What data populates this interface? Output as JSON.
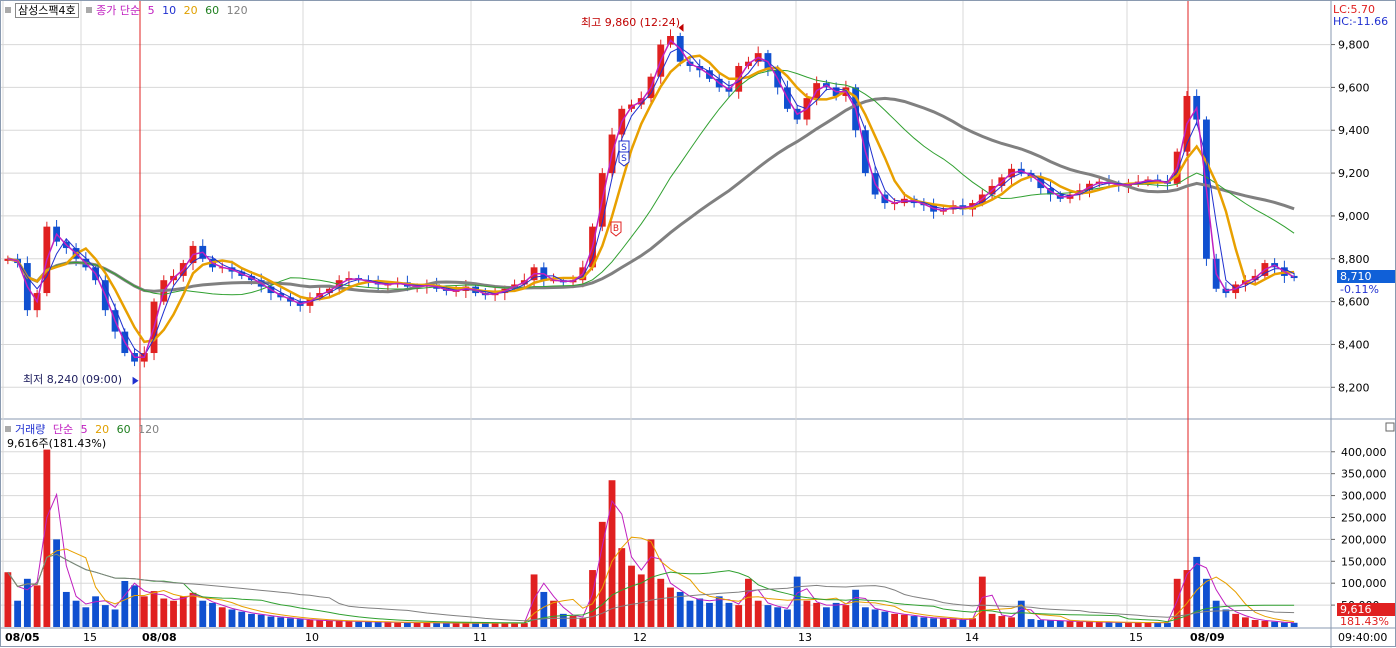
{
  "price_legend": {
    "symbol": "삼성스팩4호",
    "type_label": "종가 단순",
    "periods": [
      "5",
      "10",
      "20",
      "60",
      "120"
    ],
    "period_colors": [
      "#c020c0",
      "#2030d0",
      "#e0a000",
      "#208020",
      "#808080"
    ]
  },
  "volume_legend": {
    "title": "거래량",
    "type_label": "단순",
    "periods": [
      "5",
      "20",
      "60",
      "120"
    ],
    "period_colors": [
      "#c020c0",
      "#e0a000",
      "#208020",
      "#808080"
    ],
    "value_text": "9,616주(181.43%)"
  },
  "indicators": {
    "lc": "LC:5.70",
    "hc": "HC:-11.66"
  },
  "price_tag": {
    "value": "8,710",
    "change": "-0.11%"
  },
  "volume_tag": {
    "value": "9,616",
    "pct": "181.43%"
  },
  "annotations": {
    "high": "최고 9,860 (12:24)",
    "low": "최저 8,240 (09:00)",
    "signals": [
      "S",
      "S",
      "B"
    ]
  },
  "x_labels": [
    "08/05",
    "15",
    "08/08",
    "10",
    "11",
    "12",
    "13",
    "14",
    "15",
    "08/09"
  ],
  "time_label": "09:40:00",
  "colors": {
    "up": "#e02020",
    "down": "#1050d0",
    "ma5": "#c020c0",
    "ma10": "#2030d0",
    "ma20": "#e8a000",
    "ma60": "#30a030",
    "ma120": "#808080",
    "grid": "#d8d8d8"
  },
  "chart_data": [
    {
      "type": "candlestick",
      "title": "삼성스팩4호",
      "y_ticks": [
        8200,
        8400,
        8600,
        8800,
        9000,
        9200,
        9400,
        9600,
        9800
      ],
      "ylim": [
        8080,
        9910
      ],
      "day_labels": [
        "08/05",
        "15",
        "08/08",
        "10",
        "11",
        "12",
        "13",
        "14",
        "15",
        "08/09"
      ],
      "close_path": [
        8800,
        8780,
        8560,
        8640,
        8950,
        8880,
        8850,
        8800,
        8760,
        8700,
        8560,
        8460,
        8360,
        8320,
        8360,
        8600,
        8700,
        8720,
        8780,
        8860,
        8800,
        8760,
        8760,
        8740,
        8720,
        8700,
        8670,
        8640,
        8620,
        8600,
        8580,
        8620,
        8640,
        8660,
        8700,
        8710,
        8700,
        8690,
        8680,
        8680,
        8690,
        8670,
        8670,
        8680,
        8660,
        8650,
        8650,
        8670,
        8640,
        8630,
        8640,
        8660,
        8680,
        8700,
        8760,
        8700,
        8700,
        8690,
        8700,
        8760,
        8950,
        9200,
        9380,
        9500,
        9520,
        9550,
        9650,
        9800,
        9840,
        9720,
        9700,
        9680,
        9640,
        9600,
        9580,
        9700,
        9720,
        9760,
        9680,
        9600,
        9500,
        9450,
        9550,
        9620,
        9600,
        9560,
        9600,
        9400,
        9200,
        9100,
        9060,
        9060,
        9080,
        9060,
        9050,
        9020,
        9030,
        9050,
        9030,
        9060,
        9100,
        9140,
        9180,
        9220,
        9200,
        9180,
        9130,
        9100,
        9080,
        9100,
        9120,
        9150,
        9160,
        9150,
        9140,
        9150,
        9160,
        9170,
        9160,
        9150,
        9300,
        9560,
        9450,
        8800,
        8660,
        8640,
        8680,
        8700,
        8720,
        8780,
        8760,
        8720,
        8710
      ],
      "day_bounds": [
        0,
        12,
        33,
        52,
        72,
        90,
        104,
        117
      ],
      "high": {
        "value": 9860,
        "time": "12:24"
      },
      "low": {
        "value": 8240,
        "time": "09:00"
      },
      "last": 8710,
      "change_pct": -0.11,
      "series": [
        {
          "name": "5"
        },
        {
          "name": "10"
        },
        {
          "name": "20"
        },
        {
          "name": "60"
        },
        {
          "name": "120"
        }
      ]
    },
    {
      "type": "bar",
      "title": "거래량",
      "y_ticks": [
        50000,
        100000,
        150000,
        200000,
        250000,
        300000,
        350000,
        400000
      ],
      "ylim": [
        0,
        420000
      ],
      "values": [
        125000,
        60000,
        110000,
        95000,
        405000,
        200000,
        80000,
        60000,
        45000,
        70000,
        50000,
        40000,
        105000,
        95000,
        70000,
        82000,
        65000,
        60000,
        70000,
        78000,
        60000,
        55000,
        45000,
        40000,
        35000,
        30000,
        28000,
        24000,
        22000,
        20000,
        18000,
        16000,
        15000,
        14000,
        14000,
        13000,
        12000,
        12000,
        11000,
        11000,
        10000,
        10000,
        10000,
        10000,
        9000,
        9000,
        9000,
        9000,
        9000,
        9000,
        9000,
        9000,
        9000,
        9000,
        120000,
        80000,
        60000,
        30000,
        25000,
        20000,
        130000,
        240000,
        335000,
        180000,
        140000,
        120000,
        200000,
        110000,
        90000,
        80000,
        60000,
        65000,
        55000,
        70000,
        55000,
        50000,
        110000,
        60000,
        50000,
        45000,
        40000,
        115000,
        60000,
        55000,
        45000,
        55000,
        50000,
        85000,
        45000,
        40000,
        35000,
        30000,
        28000,
        25000,
        22000,
        20000,
        20000,
        18000,
        16000,
        20000,
        115000,
        30000,
        25000,
        22000,
        60000,
        18000,
        16000,
        15000,
        14000,
        13000,
        12000,
        12000,
        11000,
        11000,
        10000,
        10000,
        10000,
        10000,
        10000,
        10000,
        110000,
        130000,
        160000,
        110000,
        60000,
        40000,
        30000,
        22000,
        16000,
        14000,
        12000,
        10000,
        9616
      ],
      "last": 9616,
      "last_pct": 181.43,
      "series": [
        {
          "name": "5"
        },
        {
          "name": "20"
        },
        {
          "name": "60"
        },
        {
          "name": "120"
        }
      ]
    }
  ]
}
